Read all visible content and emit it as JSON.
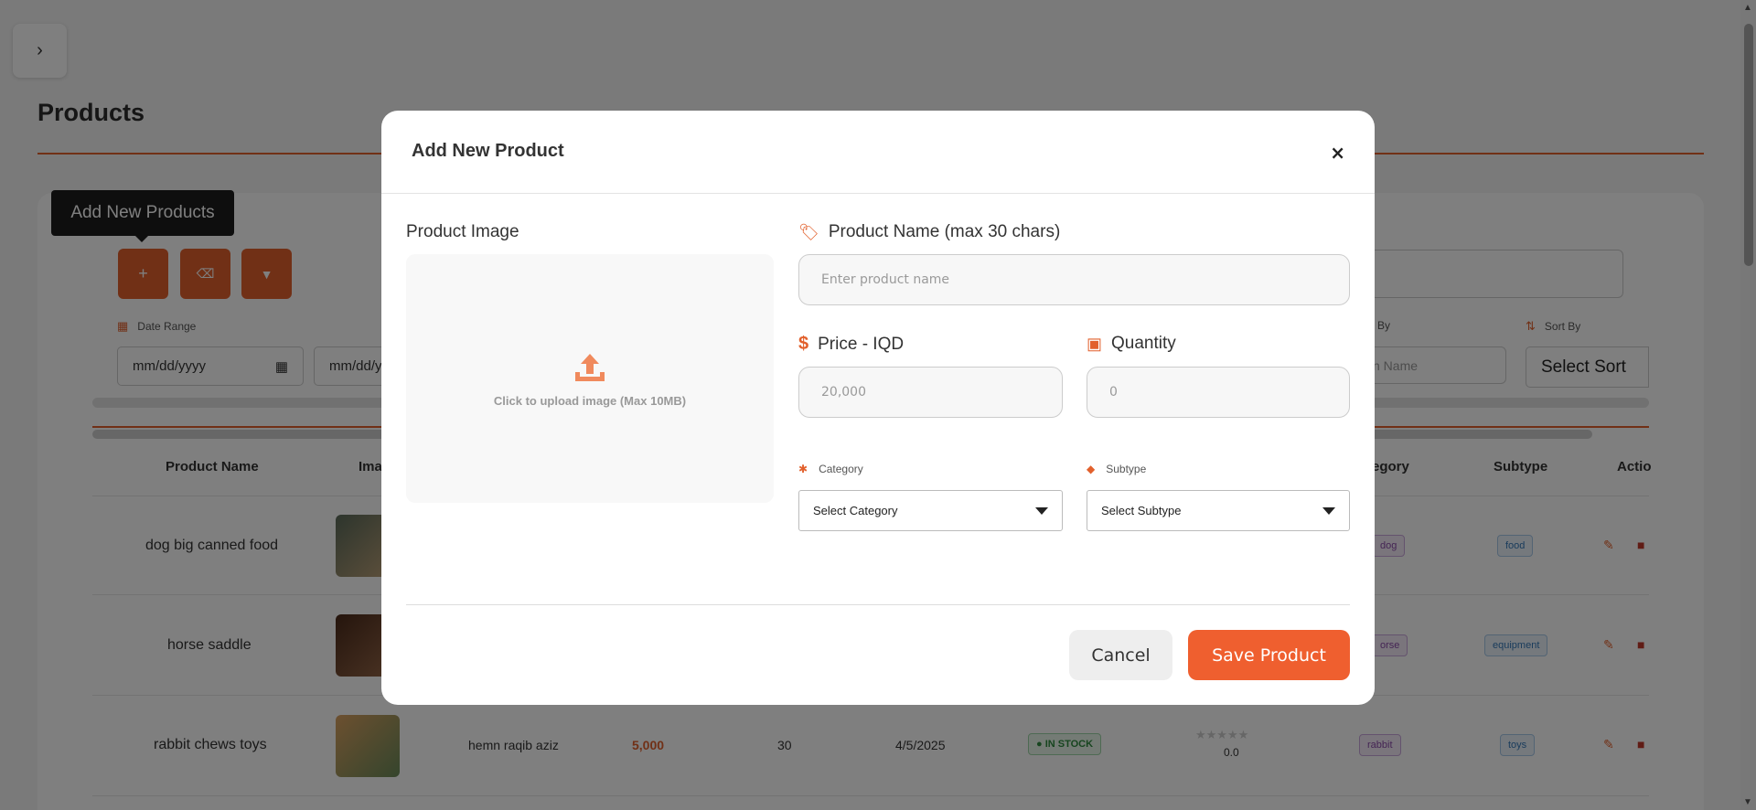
{
  "page": {
    "title": "Products",
    "tooltip": "Add New Products",
    "toolbar": {
      "add_symbol": "+",
      "erase_symbol": "⌫",
      "filter_symbol": "▼"
    },
    "filters": {
      "date_range_label": "Date Range",
      "date_from_placeholder": "mm/dd/yyyy",
      "date_to_placeholder": "mm/dd/yyyy",
      "sort_by_partial": "By",
      "sort_by_label": "Sort By",
      "sort_name_placeholder": "n Name",
      "sort_select": "Select Sort"
    },
    "table": {
      "headers": {
        "product_name": "Product Name",
        "image": "Ima",
        "category": "egory",
        "subtype": "Subtype",
        "actions": "Actio"
      },
      "rows": [
        {
          "name": "dog big canned food",
          "category": "dog",
          "subtype": "food"
        },
        {
          "name": "horse saddle",
          "category": "orse",
          "subtype": "equipment"
        },
        {
          "name": "rabbit chews toys",
          "seller": "hemn raqib aziz",
          "price": "5,000",
          "quantity": "30",
          "date": "4/5/2025",
          "status": "IN STOCK",
          "rating": "0.0",
          "category": "rabbit",
          "subtype": "toys"
        }
      ]
    }
  },
  "modal": {
    "title": "Add New Product",
    "close": "×",
    "image_label": "Product Image",
    "upload_text": "Click to upload image (Max 10MB)",
    "name_label": "Product Name (max 30 chars)",
    "name_placeholder": "Enter product name",
    "price_label": "Price - IQD",
    "price_placeholder": "20,000",
    "quantity_label": "Quantity",
    "quantity_placeholder": "0",
    "category_label": "Category",
    "category_select": "Select Category",
    "subtype_label": "Subtype",
    "subtype_select": "Select Subtype",
    "cancel": "Cancel",
    "save": "Save Product"
  },
  "colors": {
    "accent": "#e2602c",
    "save": "#ef5f2f"
  }
}
